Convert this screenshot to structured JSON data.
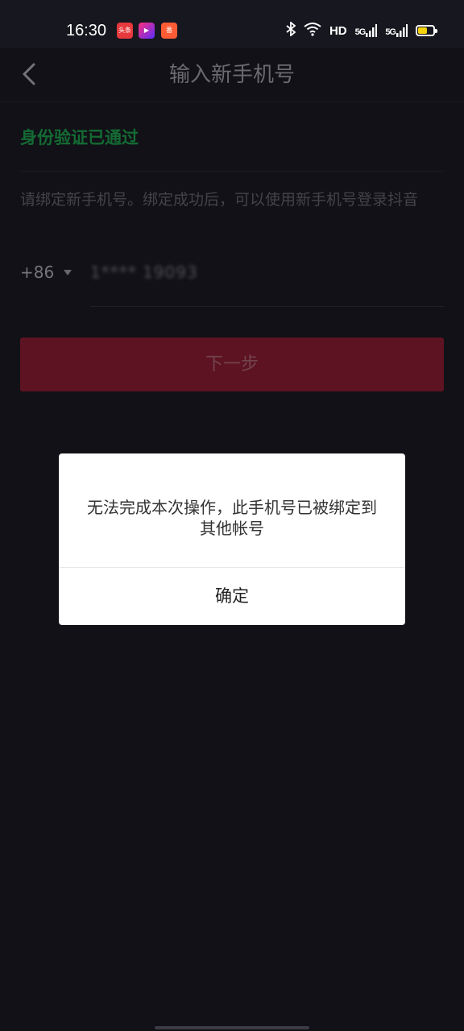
{
  "status_bar": {
    "time": "16:30",
    "apps": [
      {
        "name": "toutiao",
        "label": "头条"
      },
      {
        "name": "video",
        "label": "▶"
      },
      {
        "name": "fan",
        "label": "番"
      }
    ],
    "hd": "HD",
    "signal_1": "5G",
    "signal_2": "5G",
    "battery_level": 0.55,
    "battery_color": "#f5d30b"
  },
  "nav": {
    "title": "输入新手机号"
  },
  "verification": {
    "status": "身份验证已通过",
    "color": "#1b8f45"
  },
  "hint": "请绑定新手机号。绑定成功后，可以使用新手机号登录抖音",
  "phone": {
    "country_code": "+86",
    "value": "1**** 19093"
  },
  "next_button": {
    "label": "下一步",
    "color": "#7c1a2e"
  },
  "dialog": {
    "message": "无法完成本次操作，此手机号已被绑定到其他帐号",
    "confirm_label": "确定"
  }
}
